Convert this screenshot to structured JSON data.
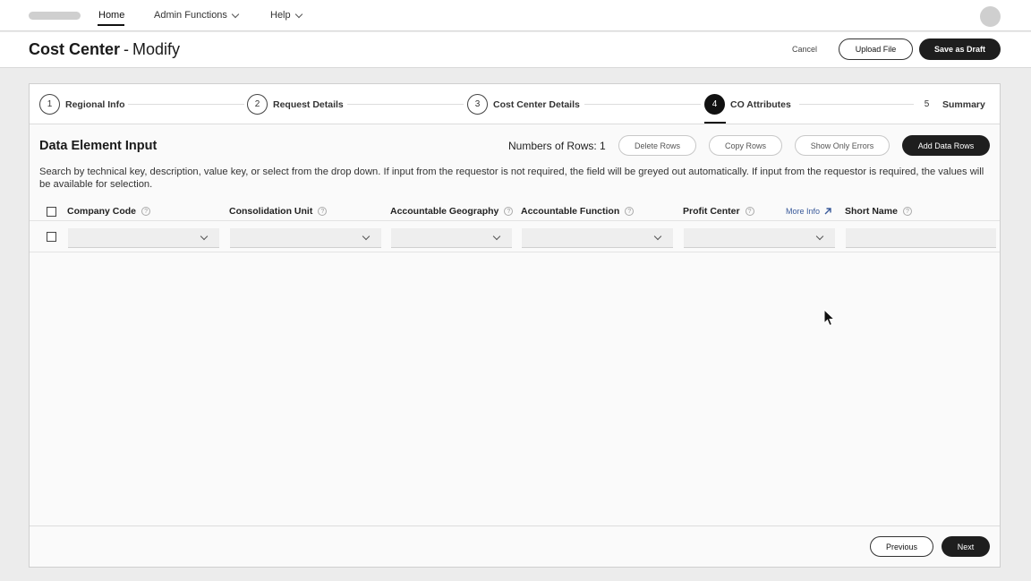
{
  "nav": {
    "items": [
      {
        "label": "Home",
        "active": true
      },
      {
        "label": "Admin Functions",
        "dropdown": true
      },
      {
        "label": "Help",
        "dropdown": true
      }
    ]
  },
  "header": {
    "title": "Cost Center",
    "separator": "-",
    "subtitle": "Modify",
    "cancel_label": "Cancel",
    "upload_label": "Upload File",
    "save_draft_label": "Save as Draft"
  },
  "steps": [
    {
      "number": "1",
      "label": "Regional Info"
    },
    {
      "number": "2",
      "label": "Request Details"
    },
    {
      "number": "3",
      "label": "Cost Center Details"
    },
    {
      "number": "4",
      "label": "CO Attributes",
      "active": true
    },
    {
      "number": "5",
      "label": "Summary"
    }
  ],
  "section": {
    "title": "Data Element Input",
    "rows_count": "Numbers of Rows: 1",
    "delete_rows_label": "Delete Rows",
    "copy_rows_label": "Copy Rows",
    "show_errors_label": "Show Only Errors",
    "add_rows_label": "Add Data Rows",
    "help_text": "Search by technical key, description, value key, or select from the drop down. If input from the requestor is not required, the field will be greyed out automatically. If input from the requestor is required, the values will be available for selection."
  },
  "table": {
    "columns": [
      {
        "label": "Company Code"
      },
      {
        "label": "Consolidation Unit"
      },
      {
        "label": "Accountable Geography"
      },
      {
        "label": "Accountable Function"
      },
      {
        "label": "Profit Center"
      },
      {
        "label": "Short Name"
      }
    ],
    "more_info_label": "More Info",
    "rows": [
      {
        "company_code": "",
        "consolidation_unit": "",
        "accountable_geography": "",
        "accountable_function": "",
        "profit_center": "",
        "short_name": ""
      }
    ]
  },
  "footer": {
    "previous_label": "Previous",
    "next_label": "Next"
  },
  "icons": {
    "help": "question-circle-icon",
    "external_link": "arrow-up-right-icon",
    "dropdown": "chevron-down-icon"
  }
}
